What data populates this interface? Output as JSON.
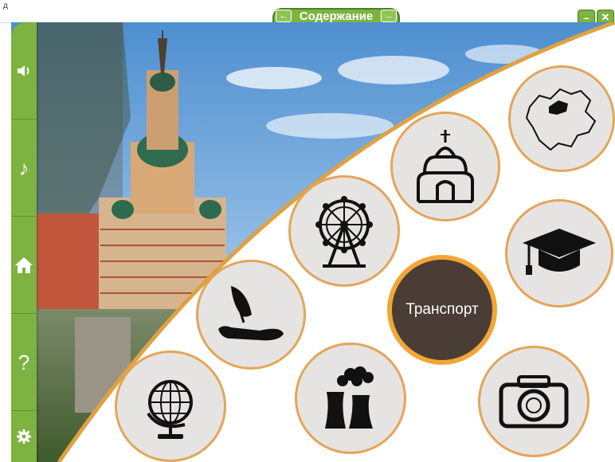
{
  "window": {
    "corner_text": "д",
    "toc_label": "Содержание",
    "prev_symbol": "←",
    "next_symbol": "→",
    "minimize_symbol": "–",
    "close_symbol": "✕"
  },
  "sidebar": {
    "items": [
      {
        "name": "sound",
        "icon": "speaker-icon"
      },
      {
        "name": "music",
        "icon": "music-note-icon",
        "glyph": "♪"
      },
      {
        "name": "home",
        "icon": "home-icon"
      },
      {
        "name": "help",
        "icon": "question-icon",
        "glyph": "?"
      },
      {
        "name": "settings",
        "icon": "gear-icon"
      }
    ]
  },
  "menu": {
    "items": [
      {
        "name": "map",
        "icon": "region-map-icon"
      },
      {
        "name": "architecture",
        "icon": "cathedral-icon"
      },
      {
        "name": "education",
        "icon": "graduation-cap-icon"
      },
      {
        "name": "attractions",
        "icon": "ferris-wheel-icon"
      },
      {
        "name": "transport",
        "label": "Транспорт",
        "active": true
      },
      {
        "name": "literature",
        "icon": "quill-icon"
      },
      {
        "name": "geography",
        "icon": "globe-icon"
      },
      {
        "name": "industry",
        "icon": "factory-icon"
      },
      {
        "name": "photo",
        "icon": "camera-icon"
      }
    ]
  },
  "colors": {
    "accent_green": "#7cb341",
    "ring_gold": "#e3a55a",
    "active_ring": "#f2a636",
    "active_fill": "#4a3d36"
  }
}
